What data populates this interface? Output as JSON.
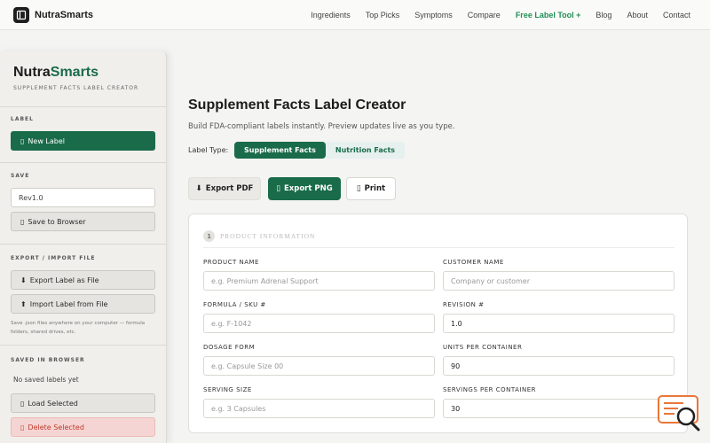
{
  "nav": {
    "brand": "NutraSmarts",
    "links": [
      "Ingredients",
      "Top Picks",
      "Symptoms",
      "Compare",
      "Free Label Tool +",
      "Blog",
      "About",
      "Contact"
    ]
  },
  "sidebar": {
    "title_a": "Nutra",
    "title_b": "Smarts",
    "subtitle": "SUPPLEMENT FACTS LABEL CREATOR",
    "label_section": "LABEL",
    "new_label": "New Label",
    "save_section": "SAVE",
    "revision_value": "Rev1.0",
    "save_browser": "Save to Browser",
    "export_section": "EXPORT / IMPORT FILE",
    "export_file": "Export Label as File",
    "import_file": "Import Label from File",
    "note": "Save .json files anywhere on your computer — formula folders, shared drives, etc.",
    "saved_section": "SAVED IN BROWSER",
    "no_saved": "No saved labels yet",
    "load_selected": "Load Selected",
    "delete_selected": "Delete Selected"
  },
  "main": {
    "title": "Supplement Facts Label Creator",
    "subtitle": "Build FDA-compliant labels instantly. Preview updates live as you type.",
    "label_type_label": "Label Type:",
    "label_types": [
      "Supplement Facts",
      "Nutrition Facts"
    ],
    "export_pdf": "Export PDF",
    "export_png": "Export PNG",
    "print": "Print"
  },
  "form": {
    "step": "1",
    "section_title": "PRODUCT INFORMATION",
    "product_name": {
      "label": "PRODUCT NAME",
      "placeholder": "e.g. Premium Adrenal Support",
      "value": ""
    },
    "customer_name": {
      "label": "CUSTOMER NAME",
      "placeholder": "Company or customer",
      "value": ""
    },
    "formula_sku": {
      "label": "FORMULA / SKU #",
      "placeholder": "e.g. F-1042",
      "value": ""
    },
    "revision": {
      "label": "REVISION #",
      "placeholder": "",
      "value": "1.0"
    },
    "dosage_form": {
      "label": "DOSAGE FORM",
      "placeholder": "e.g. Capsule Size 00",
      "value": ""
    },
    "units_per_container": {
      "label": "UNITS PER CONTAINER",
      "placeholder": "",
      "value": "90"
    },
    "serving_size": {
      "label": "SERVING SIZE",
      "placeholder": "e.g. 3 Capsules",
      "value": ""
    },
    "servings_per_container": {
      "label": "SERVINGS PER CONTAINER",
      "placeholder": "",
      "value": "30"
    }
  },
  "colors": {
    "accent": "#1a6b4a",
    "nav_accent": "#1f8f55",
    "danger": "#c0392b",
    "widget_orange": "#e8773a"
  },
  "icons": {
    "brand": "book-icon",
    "new_label": "plus-icon",
    "save": "floppy-disk-icon",
    "export": "download-icon",
    "import": "upload-icon",
    "load": "folder-icon",
    "delete": "trash-icon",
    "export_png": "image-icon",
    "print": "printer-icon",
    "widget": "search-chat-icon"
  }
}
